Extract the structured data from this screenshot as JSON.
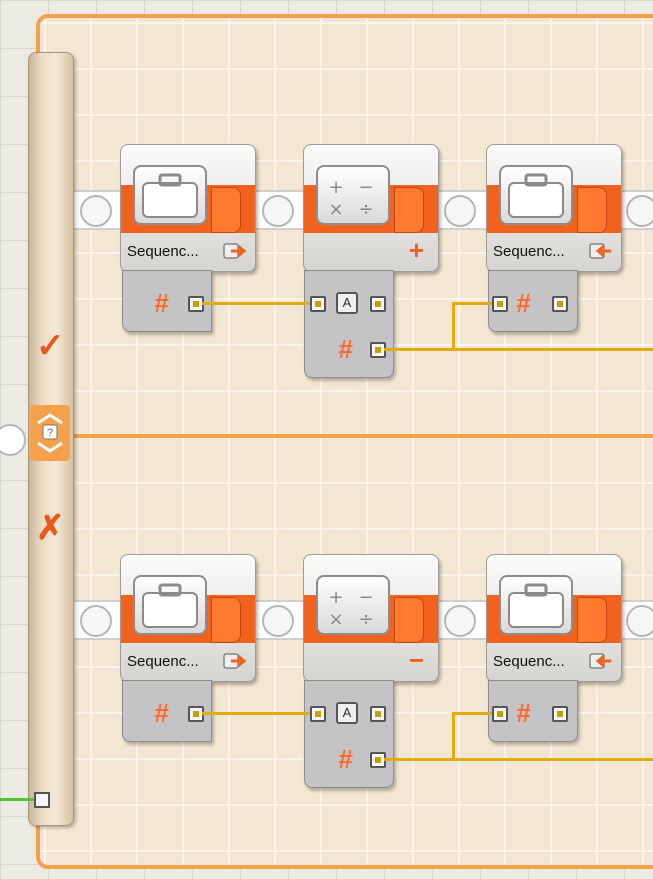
{
  "switch": {
    "true_mark": "✓",
    "false_mark": "✗"
  },
  "branches": [
    {
      "blocks": [
        {
          "type": "variable",
          "label": "Sequenc...",
          "direction": "write",
          "icon": "briefcase-icon"
        },
        {
          "type": "math",
          "operator": "+",
          "icon": "math-operators-icon"
        },
        {
          "type": "variable",
          "label": "Sequenc...",
          "direction": "read",
          "icon": "briefcase-icon"
        }
      ]
    },
    {
      "blocks": [
        {
          "type": "variable",
          "label": "Sequenc...",
          "direction": "write",
          "icon": "briefcase-icon"
        },
        {
          "type": "math",
          "operator": "−",
          "icon": "math-operators-icon"
        },
        {
          "type": "variable",
          "label": "Sequenc...",
          "direction": "read",
          "icon": "briefcase-icon"
        }
      ]
    }
  ],
  "plugs": {
    "number_symbol": "#",
    "a_label": "A"
  },
  "colors": {
    "orange": "#f2621f",
    "frame": "#f5a14c",
    "wire": "#e1ac12",
    "green_wire": "#5bbf3a"
  }
}
